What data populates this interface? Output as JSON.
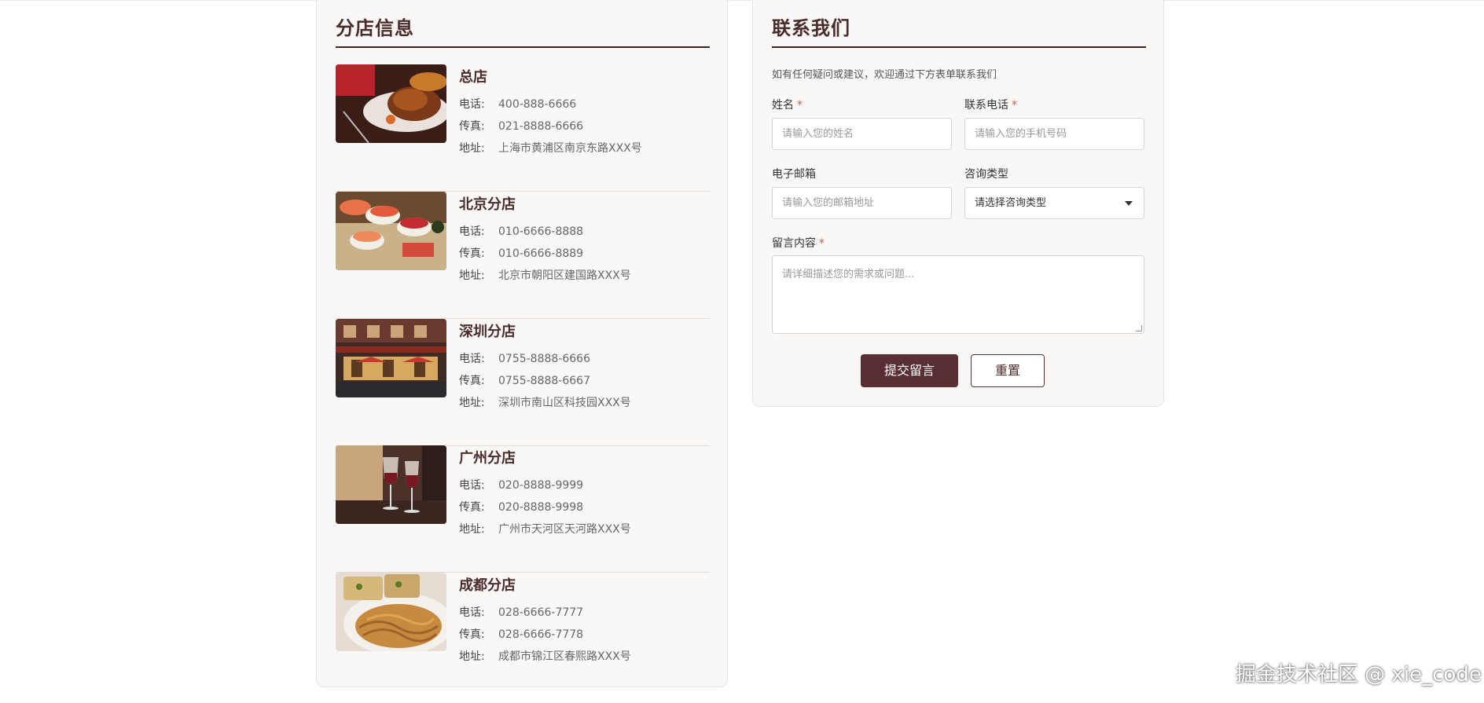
{
  "branches": {
    "title": "分店信息",
    "labels": {
      "phone": "电话:",
      "fax": "传真:",
      "address": "地址:"
    },
    "stores": [
      {
        "name": "总店",
        "phone": "400-888-6666",
        "fax": "021-8888-6666",
        "address": "上海市黄浦区南京东路XXX号",
        "image": "roast-chicken-photo"
      },
      {
        "name": "北京分店",
        "phone": "010-6666-8888",
        "fax": "010-6666-8889",
        "address": "北京市朝阳区建国路XXX号",
        "image": "sushi-platter-photo"
      },
      {
        "name": "深圳分店",
        "phone": "0755-8888-6666",
        "fax": "0755-8888-6667",
        "address": "深圳市南山区科技园XXX号",
        "image": "restaurant-storefront-photo"
      },
      {
        "name": "广州分店",
        "phone": "020-8888-9999",
        "fax": "020-8888-9998",
        "address": "广州市天河区天河路XXX号",
        "image": "wine-glasses-photo"
      },
      {
        "name": "成都分店",
        "phone": "028-6666-7777",
        "fax": "028-6666-7778",
        "address": "成都市锦江区春熙路XXX号",
        "image": "spaghetti-photo"
      }
    ]
  },
  "contact": {
    "title": "联系我们",
    "intro": "如有任何疑问或建议，欢迎通过下方表单联系我们",
    "required_mark": "*",
    "name_label": "姓名",
    "name_placeholder": "请输入您的姓名",
    "phone_label": "联系电话",
    "phone_placeholder": "请输入您的手机号码",
    "email_label": "电子邮箱",
    "email_placeholder": "请输入您的邮箱地址",
    "type_label": "咨询类型",
    "type_selected": "请选择咨询类型",
    "message_label": "留言内容",
    "message_placeholder": "请详细描述您的需求或问题...",
    "submit_label": "提交留言",
    "reset_label": "重置"
  },
  "watermark": "掘金技术社区 @ xie_code",
  "colors": {
    "accent": "#5a2f33",
    "heading": "#4a2c2a",
    "required": "#d9534f",
    "panel_bg": "#f9f8f7"
  }
}
